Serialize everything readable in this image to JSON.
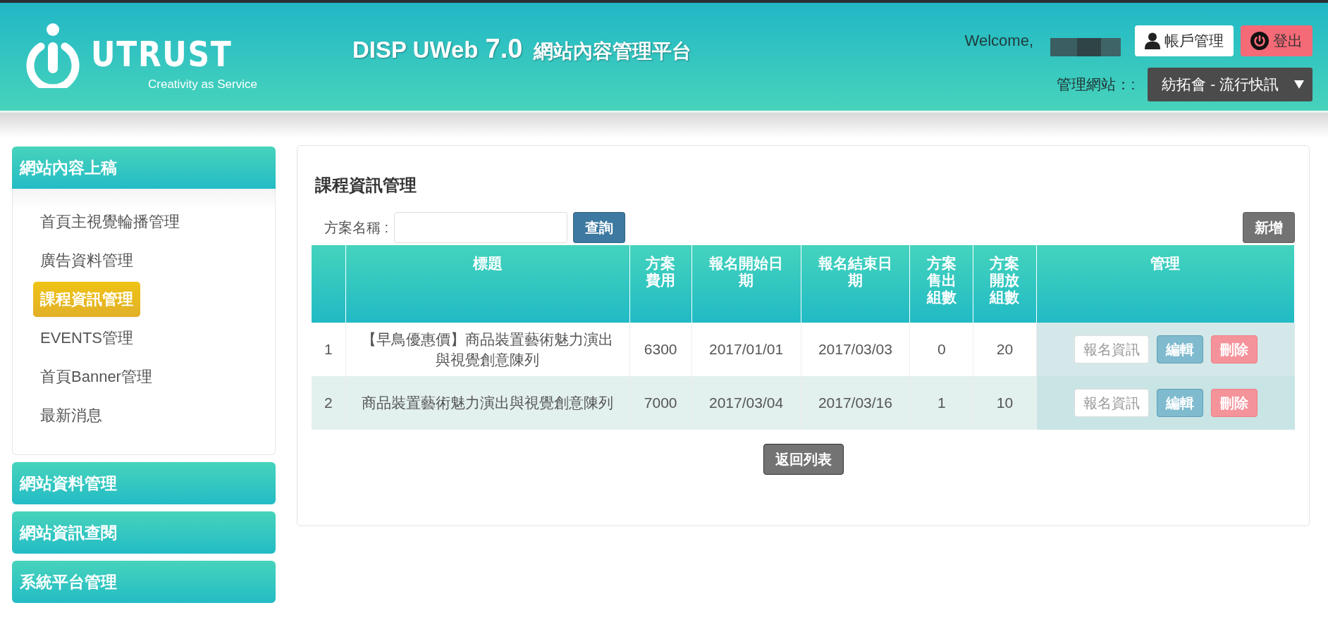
{
  "header": {
    "logo": {
      "name": "UTRUST",
      "tagline": "Creativity as Service"
    },
    "title": {
      "product": "DISP UWeb",
      "version": "7.0",
      "subtitle": "網站內容管理平台"
    },
    "welcome": "Welcome,",
    "account_button": "帳戶管理",
    "logout_button": "登出",
    "site_label": "管理網站：:",
    "site_select": "紡拓會 - 流行快訊"
  },
  "sidebar": {
    "sections": [
      {
        "label": "網站內容上稿",
        "expanded": true,
        "items": [
          {
            "label": "首頁主視覺輪播管理",
            "selected": false
          },
          {
            "label": "廣告資料管理",
            "selected": false
          },
          {
            "label": "課程資訊管理",
            "selected": true
          },
          {
            "label": "EVENTS管理",
            "selected": false
          },
          {
            "label": "首頁Banner管理",
            "selected": false
          },
          {
            "label": "最新消息",
            "selected": false
          }
        ]
      },
      {
        "label": "網站資料管理",
        "expanded": false
      },
      {
        "label": "網站資訊查閱",
        "expanded": false
      },
      {
        "label": "系統平台管理",
        "expanded": false
      }
    ]
  },
  "main": {
    "title": "課程資訊管理",
    "search": {
      "label": "方案名稱 :",
      "button": "查詢"
    },
    "add_button": "新增",
    "table": {
      "columns": [
        "",
        "標題",
        "方案費用",
        "報名開始日期",
        "報名結束日期",
        "方案售出組數",
        "方案開放組數",
        "管理"
      ],
      "rows": [
        {
          "cells": [
            "1",
            "【早鳥優惠價】商品裝置藝術魅力演出與視覺創意陳列",
            "6300",
            "2017/01/01",
            "2017/03/03",
            "0",
            "20"
          ],
          "actions": [
            "報名資訊",
            "編輯",
            "刪除"
          ]
        },
        {
          "cells": [
            "2",
            "商品裝置藝術魅力演出與視覺創意陳列",
            "7000",
            "2017/03/04",
            "2017/03/16",
            "1",
            "10"
          ],
          "actions": [
            "報名資訊",
            "編輯",
            "刪除"
          ]
        }
      ]
    },
    "back_button": "返回列表"
  }
}
